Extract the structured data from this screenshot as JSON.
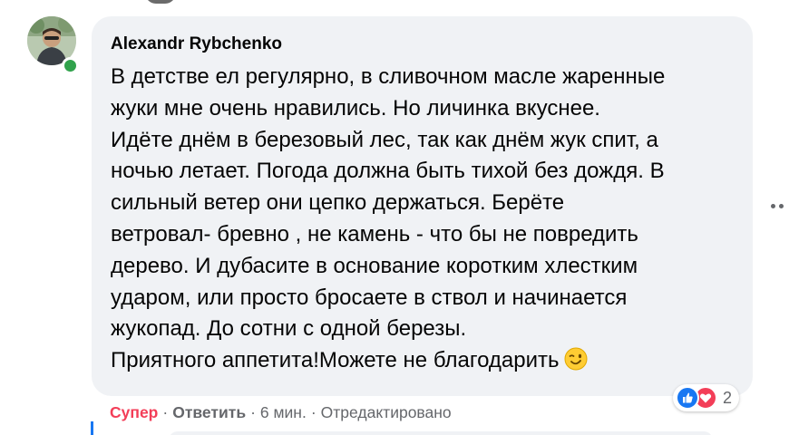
{
  "comment": {
    "author": "Alexandr Rybchenko",
    "lines": [
      "В детстве ел регулярно, в сливочном масле жаренные",
      "жуки мне очень нравились. Но личинка вкуснее.",
      "Идёте днём в березовый лес, так как днём жук спит, а",
      "ночью летает. Погода должна быть тихой без дождя. В",
      "сильный ветер они цепко держаться. Берёте",
      "ветровал- бревно , не камень - что бы не повредить",
      "дерево. И дубасите в основание коротким хлестким",
      "ударом, или просто бросаете в ствол и начинается",
      "жукопад. До сотни с одной березы.",
      "Приятного аппетита!Можете не благодарить"
    ],
    "end_emoji": "winking-face-emoji"
  },
  "actions": {
    "reaction_label": "Супер",
    "reply_label": "Ответить",
    "time": "6 мин.",
    "edited": "Отредактировано",
    "separator": "·"
  },
  "reactions": {
    "icons": [
      "like-icon",
      "care-heart-icon"
    ],
    "count": "2"
  },
  "colors": {
    "bubble_bg": "#f0f2f5",
    "super_red": "#f33e58",
    "like_blue": "#1877f2",
    "online_green": "#31a24c",
    "meta_gray": "#65676b"
  }
}
